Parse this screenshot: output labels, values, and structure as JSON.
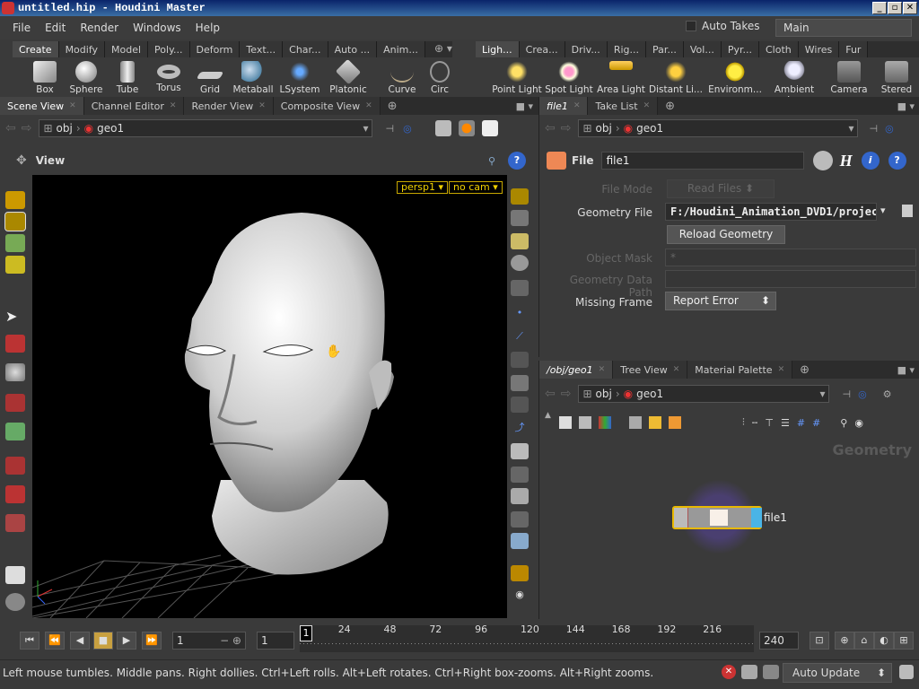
{
  "window": {
    "title": "untitled.hip - Houdini Master"
  },
  "menu": {
    "items": [
      "File",
      "Edit",
      "Render",
      "Windows",
      "Help"
    ],
    "auto_takes": "Auto Takes",
    "desktop": "Main"
  },
  "shelf_left": {
    "tabs": [
      "Create",
      "Modify",
      "Model",
      "Poly...",
      "Deform",
      "Text...",
      "Char...",
      "Auto ...",
      "Anim..."
    ],
    "tools": [
      "Box",
      "Sphere",
      "Tube",
      "Torus",
      "Grid",
      "Metaball",
      "LSystem",
      "Platonic ...",
      "Curve",
      "Circ"
    ]
  },
  "shelf_right": {
    "tabs": [
      "Ligh...",
      "Crea...",
      "Driv...",
      "Rig...",
      "Par...",
      "Vol...",
      "Pyr...",
      "Cloth",
      "Wires",
      "Fur"
    ],
    "tools": [
      "Point Light",
      "Spot Light",
      "Area Light",
      "Distant Li...",
      "Environm...",
      "Ambient L...",
      "Camera",
      "Stered"
    ]
  },
  "scene_pane": {
    "tabs": [
      "Scene View",
      "Channel Editor",
      "Render View",
      "Composite View"
    ],
    "path": [
      "obj",
      "geo1"
    ],
    "view_label": "View",
    "cam_menus": [
      "persp1",
      "no cam"
    ]
  },
  "param_pane": {
    "tabs": [
      "file1",
      "Take List"
    ],
    "path": [
      "obj",
      "geo1"
    ],
    "node_type": "File",
    "node_name": "file1",
    "params": {
      "file_mode_label": "File Mode",
      "file_mode_value": "Read Files",
      "geometry_file_label": "Geometry File",
      "geometry_file_value": "F:/Houdini_Animation_DVD1/projec",
      "reload_label": "Reload Geometry",
      "object_mask_label": "Object Mask",
      "object_mask_value": "*",
      "geo_data_path_label": "Geometry Data Path",
      "missing_frame_label": "Missing Frame",
      "missing_frame_value": "Report Error"
    }
  },
  "network_pane": {
    "tabs": [
      "/obj/geo1",
      "Tree View",
      "Material Palette"
    ],
    "path": [
      "obj",
      "geo1"
    ],
    "context_label": "Geometry",
    "node": {
      "name": "file1"
    }
  },
  "timeline": {
    "start_frame": "1",
    "current_frame_field": "1",
    "range_start": "1",
    "current_frame": "1",
    "end_frame": "240",
    "ticks": [
      "24",
      "48",
      "72",
      "96",
      "120",
      "144",
      "168",
      "192",
      "216"
    ]
  },
  "status": {
    "message": "Left mouse tumbles. Middle pans. Right dollies. Ctrl+Left rolls. Alt+Left rotates. Ctrl+Right box-zooms. Alt+Right zooms.",
    "update_mode": "Auto Update"
  }
}
